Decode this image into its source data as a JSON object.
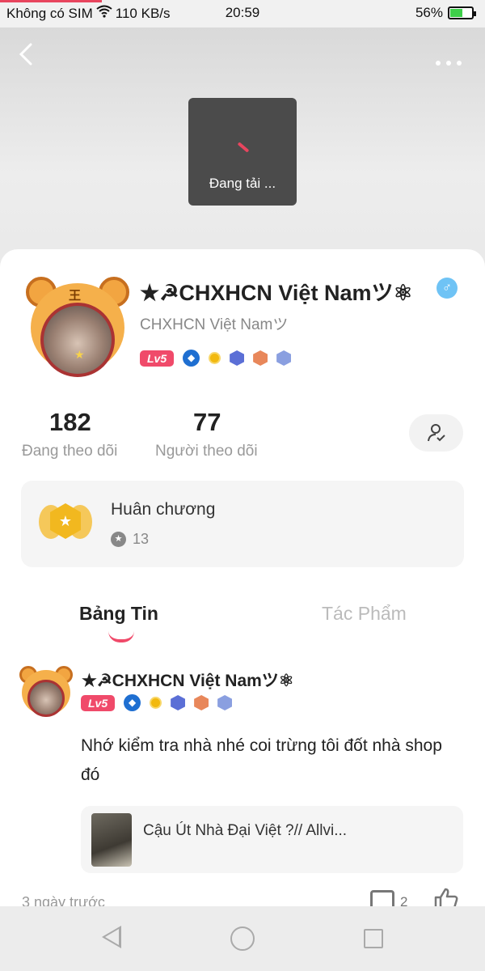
{
  "status_bar": {
    "carrier": "Không có SIM",
    "speed": "110 KB/s",
    "time": "20:59",
    "battery": "56%",
    "battery_level": 0.56
  },
  "loading": {
    "text": "Đang tải ..."
  },
  "profile": {
    "display_name": "★☭CHXHCN Việt Namツ⚛",
    "username": "CHXHCN Việt Namツ",
    "gender_icon": "♂",
    "level": "Lv5",
    "following_count": "182",
    "following_label": "Đang theo dõi",
    "followers_count": "77",
    "followers_label": "Người theo dõi"
  },
  "medals": {
    "title": "Huân chương",
    "count": "13"
  },
  "tabs": [
    {
      "label": "Bảng Tin",
      "active": true
    },
    {
      "label": "Tác Phẩm",
      "active": false
    }
  ],
  "post": {
    "author": "★☭CHXHCN Việt Namツ⚛",
    "level": "Lv5",
    "text": "Nhớ kiểm tra nhà nhé coi trừng tôi đốt nhà shop đó",
    "ref_title": "Cậu Út Nhà Đại Việt ?// Allvi...",
    "time": "3 ngày trước",
    "comments": "2"
  },
  "colors": {
    "accent": "#f04a6a",
    "gender": "#6fc3f5"
  }
}
